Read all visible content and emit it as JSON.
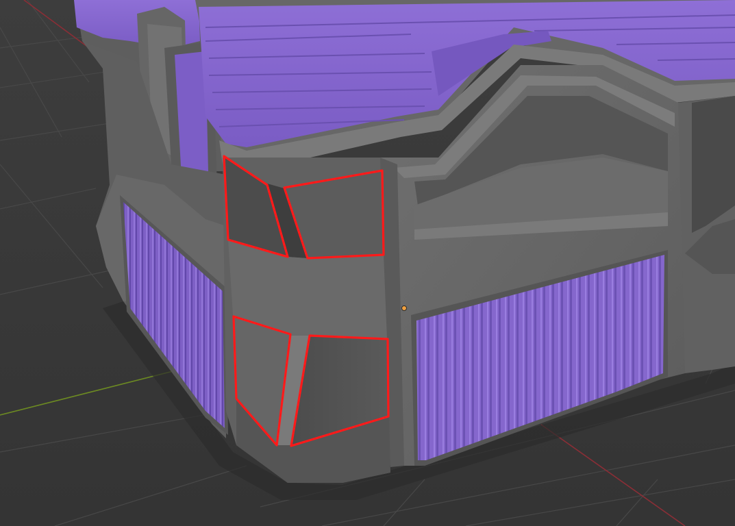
{
  "viewport": {
    "background": "#3a3a3a",
    "grid_color": "#484848",
    "axis_x_color": "#8a2e36",
    "axis_y_color": "#6c8a22"
  },
  "model": {
    "body_color": "#6e6e6e",
    "accent_color": "#8a6ad2",
    "selection_color": "#ff1a1a",
    "selected_face_count": 4,
    "origin_icon": "object-origin-dot"
  }
}
